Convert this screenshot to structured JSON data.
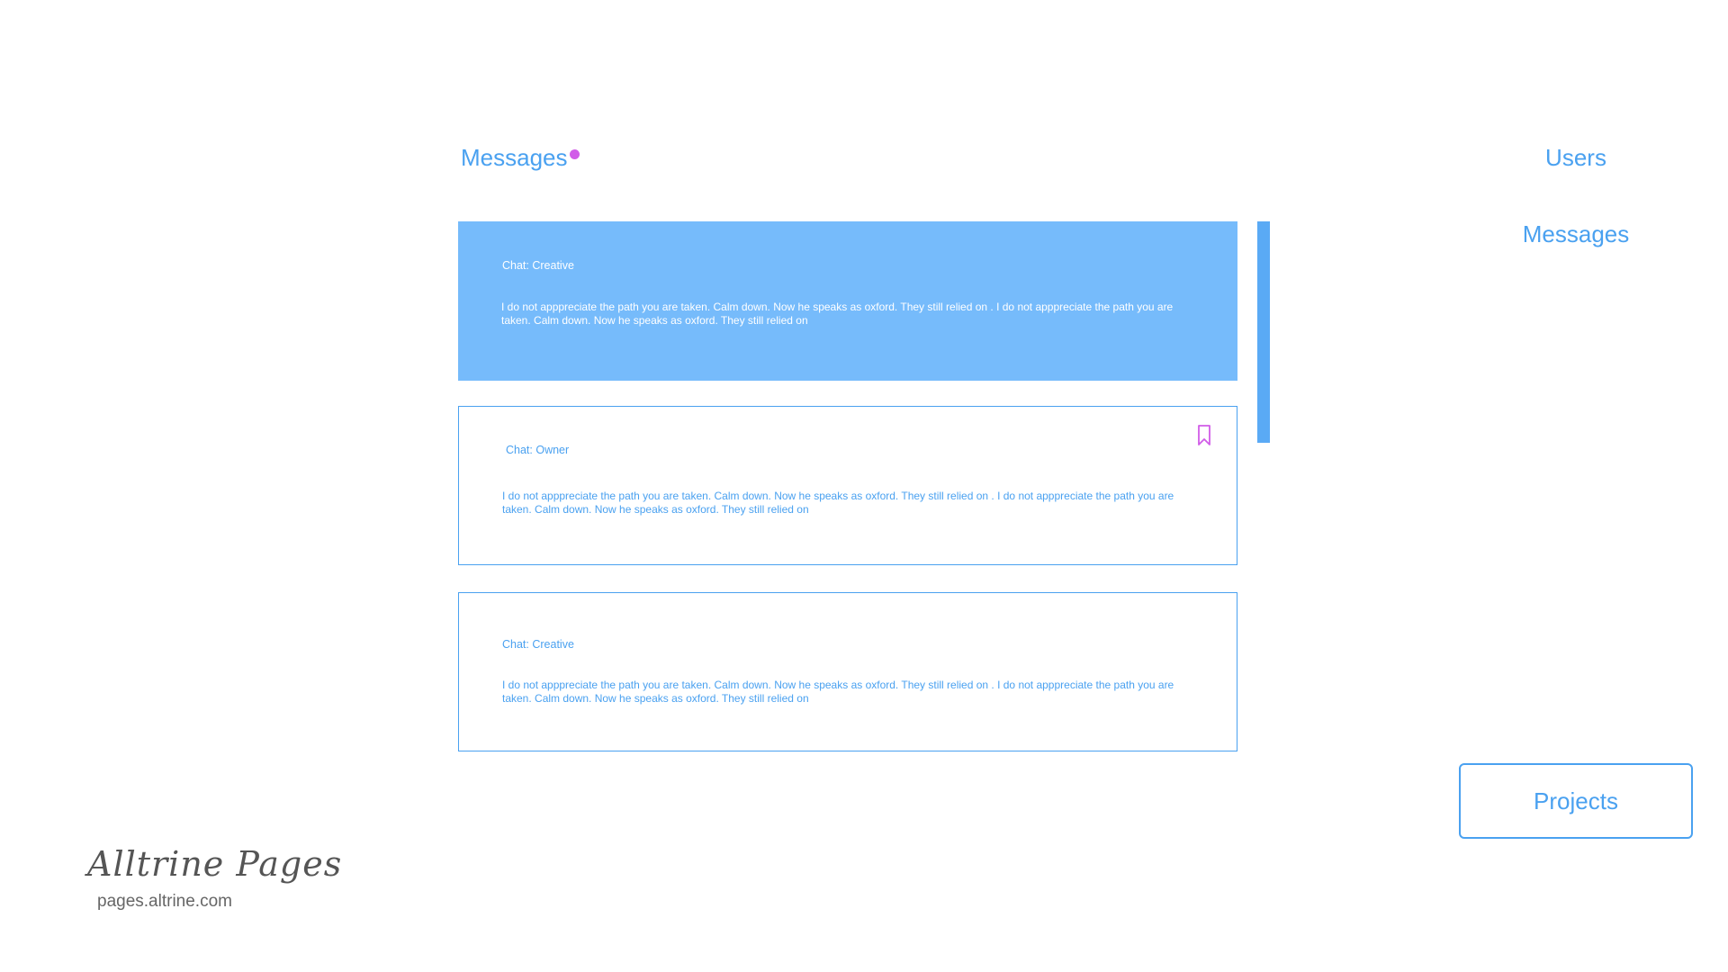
{
  "header": {
    "title": "Messages"
  },
  "messages": [
    {
      "title": "Chat: Creative",
      "body": "I do not apppreciate the path you are taken. Calm down. Now he speaks as oxford. They still relied on . I do not apppreciate the path you are taken. Calm down. Now he speaks as oxford. They still relied on",
      "selected": true
    },
    {
      "title": "Chat: Owner",
      "body": "I do not apppreciate the path you are taken. Calm down. Now he speaks as oxford. They still relied on . I do not apppreciate the path you are taken. Calm down. Now he speaks as oxford. They still relied on",
      "icon": "bookmark-icon"
    },
    {
      "title": "Chat: Creative",
      "body": "I do not apppreciate the path you are taken. Calm down. Now he speaks as oxford. They still relied on . I do not apppreciate the path you are taken. Calm down. Now he speaks as oxford. They still relied on"
    }
  ],
  "nav": {
    "users": "Users",
    "messages": "Messages",
    "projects": "Projects"
  },
  "brand": {
    "name": "Alltrine Pages",
    "url": "pages.altrine.com"
  },
  "colors": {
    "accent": "#4aa1f0",
    "selected_card": "#76bbfb",
    "notification_dot": "#d15ce8",
    "bookmark": "#d15ce8"
  }
}
